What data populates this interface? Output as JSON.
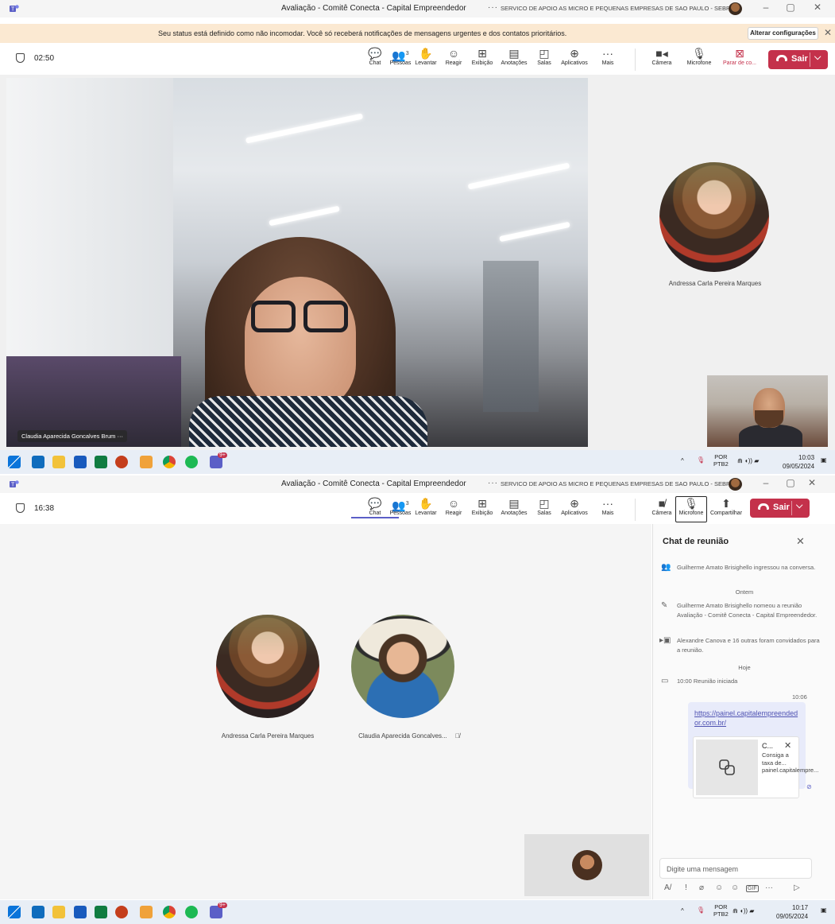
{
  "app": {
    "window_title": "Avaliação - Comitê Conecta - Capital Empreendedor",
    "org_name": "SERVICO DE APOIO AS MICRO E PEQUENAS EMPRESAS DE SAO PAULO - SEBRAE",
    "overflow_dots": "···",
    "win_minimize": "–",
    "win_restore": "▢",
    "win_close": "✕"
  },
  "notice": {
    "text": "Seu status está definido como não incomodar. Você só receberá notificações de mensagens urgentes e dos contatos prioritários.",
    "button": "Alterar configurações",
    "close": "✕"
  },
  "toolbar_top": {
    "timer": "02:50",
    "items": [
      {
        "icon": "chat-icon",
        "label": "Chat",
        "glyph": "💬"
      },
      {
        "icon": "people-icon",
        "label": "Pessoas",
        "glyph": "👥"
      },
      {
        "icon": "raise-hand-icon",
        "label": "Levantar",
        "glyph": "✋"
      },
      {
        "icon": "react-icon",
        "label": "Reagir",
        "glyph": "☺"
      },
      {
        "icon": "view-icon",
        "label": "Exibição",
        "glyph": "⊞"
      },
      {
        "icon": "notes-icon",
        "label": "Anotações",
        "glyph": "▤"
      },
      {
        "icon": "rooms-icon",
        "label": "Salas",
        "glyph": "◰"
      },
      {
        "icon": "apps-icon",
        "label": "Aplicativos",
        "glyph": "⊕"
      },
      {
        "icon": "more-icon",
        "label": "Mais",
        "glyph": "···"
      }
    ],
    "people_count": "3",
    "camera": "Câmera",
    "microphone": "Microfone",
    "share": "Parar de co...",
    "leave": "Sair"
  },
  "toolbar_bottom": {
    "timer": "16:38",
    "camera": "Câmera",
    "microphone": "Microfone",
    "share": "Compartilhar",
    "leave": "Sair"
  },
  "stage_top": {
    "main_speaker": "Claudia Aparecida Goncalves Brum",
    "main_speaker_more": "···",
    "side_participant": "Andressa Carla Pereira Marques"
  },
  "stage_bottom": {
    "participants": [
      {
        "name": "Andressa Carla Pereira Marques"
      },
      {
        "name": "Claudia Aparecida Goncalves..."
      }
    ]
  },
  "taskbar_top": {
    "lang_line1": "POR",
    "lang_line2": "PTB2",
    "time": "10:03",
    "date": "09/05/2024",
    "badge": "9+",
    "caret": "^",
    "tray_icons": "⋒ ◖)) ▰"
  },
  "taskbar_bottom": {
    "lang_line1": "POR",
    "lang_line2": "PTB2",
    "time": "10:17",
    "date": "09/05/2024",
    "badge": "9+",
    "caret": "^",
    "tray_icons": "⋒ ◖)) ▰"
  },
  "chat": {
    "title": "Chat de reunião",
    "close": "✕",
    "events": [
      {
        "icon": "user-join-icon",
        "glyph": "👥",
        "text": "Guilherme Amato Brisighello ingressou na conversa."
      },
      {
        "icon": "pencil-icon",
        "glyph": "✎",
        "text": "Guilherme Amato Brisighello nomeou a reunião Avaliação - Comitê Conecta - Capital Empreendedor."
      },
      {
        "icon": "calendar-icon",
        "glyph": "▸▣",
        "text": "Alexandre Canova e 16 outras foram convidados para a reunião."
      },
      {
        "icon": "meeting-icon",
        "glyph": "▭",
        "text": "10:00  Reunião iniciada"
      }
    ],
    "day_yesterday": "Ontem",
    "day_today": "Hoje",
    "message_time": "10:06",
    "message_link": "https://painel.capitalempreendedor.com.br/",
    "preview_title": "C...",
    "preview_close": "✕",
    "preview_desc": "Consiga a taxa de... painel.capitalempre...",
    "seen": "⊘",
    "compose_placeholder": "Digite uma mensagem",
    "compose_tools": [
      "A/",
      "!",
      "⌀",
      "☺",
      "☺",
      "GIF",
      "···",
      "▷"
    ]
  },
  "colors": {
    "accent": "#5b5fc7",
    "leave": "#c4314b",
    "notice_bg": "#fbe9d2",
    "bubble_bg": "#e8ebfa"
  }
}
